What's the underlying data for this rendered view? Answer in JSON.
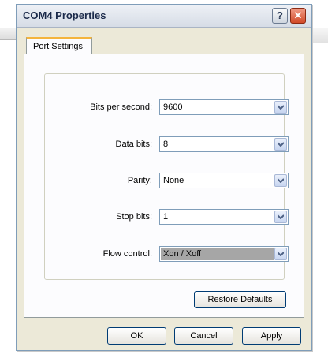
{
  "window": {
    "title": "COM4 Properties",
    "help_icon": "help-icon",
    "close_icon": "close-icon"
  },
  "tabs": [
    {
      "label": "Port Settings",
      "active": true
    }
  ],
  "fields": {
    "bits_per_second": {
      "label": "Bits per second:",
      "value": "9600"
    },
    "data_bits": {
      "label": "Data bits:",
      "value": "8"
    },
    "parity": {
      "label": "Parity:",
      "value": "None"
    },
    "stop_bits": {
      "label": "Stop bits:",
      "value": "1"
    },
    "flow_control": {
      "label": "Flow control:",
      "value": "Xon / Xoff"
    }
  },
  "buttons": {
    "restore_defaults": "Restore Defaults",
    "ok": "OK",
    "cancel": "Cancel",
    "apply": "Apply"
  },
  "colors": {
    "dialog_bg": "#ece9d8",
    "panel_bg": "#fcfcfe",
    "tab_accent": "#f4b43c",
    "border_blue": "#7f9db9"
  }
}
